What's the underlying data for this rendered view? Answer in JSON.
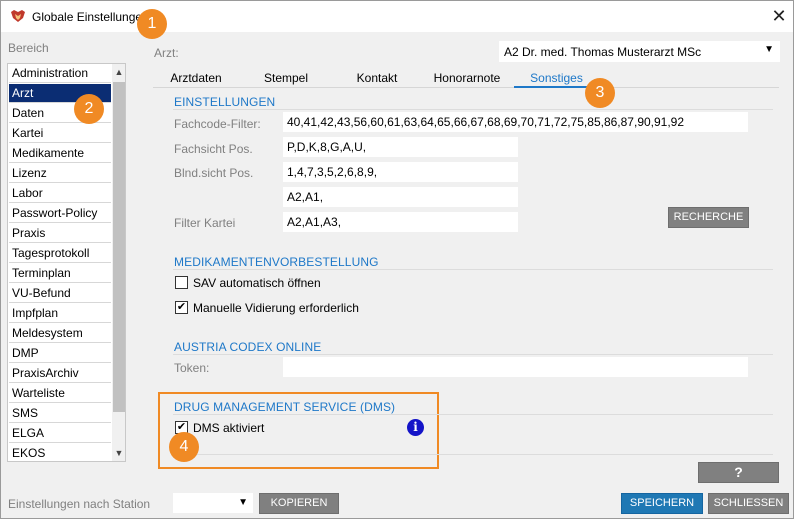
{
  "window": {
    "title": "Globale Einstellungen",
    "close_glyph": "✕"
  },
  "sidebar": {
    "label": "Bereich",
    "items": [
      {
        "label": "Administration"
      },
      {
        "label": "Arzt",
        "selected": true
      },
      {
        "label": "Daten"
      },
      {
        "label": "Kartei"
      },
      {
        "label": "Medikamente"
      },
      {
        "label": "Lizenz"
      },
      {
        "label": "Labor"
      },
      {
        "label": "Passwort-Policy"
      },
      {
        "label": "Praxis"
      },
      {
        "label": "Tagesprotokoll"
      },
      {
        "label": "Terminplan"
      },
      {
        "label": "VU-Befund"
      },
      {
        "label": "Impfplan"
      },
      {
        "label": "Meldesystem"
      },
      {
        "label": "DMP"
      },
      {
        "label": "PraxisArchiv"
      },
      {
        "label": "Warteliste"
      },
      {
        "label": "SMS"
      },
      {
        "label": "ELGA"
      },
      {
        "label": "EKOS"
      }
    ]
  },
  "arzt": {
    "label": "Arzt:",
    "selected": "A2 Dr. med. Thomas Musterarzt MSc"
  },
  "tabs": [
    {
      "label": "Arztdaten"
    },
    {
      "label": "Stempel"
    },
    {
      "label": "Kontakt"
    },
    {
      "label": "Honorarnote"
    },
    {
      "label": "Sonstiges",
      "active": true
    }
  ],
  "einstellungen": {
    "heading": "EINSTELLUNGEN",
    "fachcode_label": "Fachcode-Filter:",
    "fachcode_value": "40,41,42,43,56,60,61,63,64,65,66,67,68,69,70,71,72,75,85,86,87,90,91,92",
    "fachsicht_label": "Fachsicht Pos.",
    "fachsicht_value": "P,D,K,8,G,A,U,",
    "blindsicht_label": "Blnd.sicht Pos.",
    "blindsicht_value": "1,4,7,3,5,2,6,8,9,",
    "extra_value": "A2,A1,",
    "filter_kartei_label": "Filter Kartei",
    "filter_kartei_value": "A2,A1,A3,",
    "recherche_button": "RECHERCHE"
  },
  "medikamenten": {
    "heading": "MEDIKAMENTENVORBESTELLUNG",
    "sav_label": "SAV automatisch öffnen",
    "sav_checked": false,
    "vidierung_label": "Manuelle Vidierung erforderlich",
    "vidierung_checked": true
  },
  "austria_codex": {
    "heading": "AUSTRIA CODEX ONLINE",
    "token_label": "Token:",
    "token_value": ""
  },
  "dms": {
    "heading": "DRUG MANAGEMENT SERVICE (DMS)",
    "aktiviert_label": "DMS aktiviert",
    "aktiviert_checked": true,
    "info_glyph": "i"
  },
  "help_button": "?",
  "footer": {
    "station_label": "Einstellungen nach Station",
    "station_value": "",
    "kopieren_button": "KOPIEREN",
    "speichern_button": "SPEICHERN",
    "schliessen_button": "SCHLIESSEN"
  },
  "annotations": [
    "1",
    "2",
    "3",
    "4"
  ],
  "colors": {
    "accent_blue": "#1e78c8",
    "selected_bg": "#0b2d73",
    "badge_orange": "#f08a24",
    "button_grey": "#808080",
    "button_blue": "#1f78b4"
  }
}
